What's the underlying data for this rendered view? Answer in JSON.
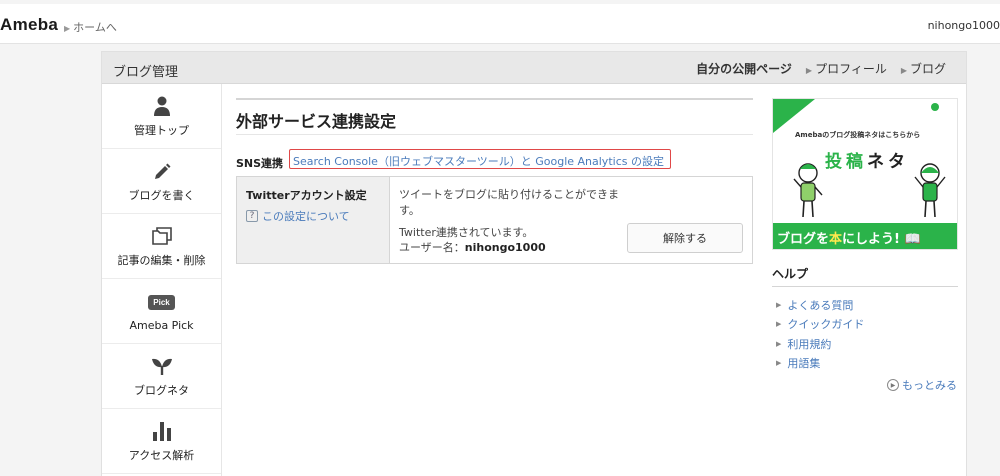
{
  "topbar": {
    "logo": "Ameba",
    "home_link": "ホームへ",
    "username": "nihongo1000"
  },
  "frame": {
    "title": "ブログ管理",
    "header_links": {
      "my_page": "自分の公開ページ",
      "profile": "プロフィール",
      "blog": "ブログ"
    }
  },
  "sidebar": {
    "items": [
      {
        "label": "管理トップ",
        "icon": "person-icon"
      },
      {
        "label": "ブログを書く",
        "icon": "pencil-icon"
      },
      {
        "label": "記事の編集・削除",
        "icon": "folder-icon"
      },
      {
        "label": "Ameba Pick",
        "icon": "pick-badge-icon",
        "badge": "Pick"
      },
      {
        "label": "ブログネタ",
        "icon": "sprout-icon"
      },
      {
        "label": "アクセス解析",
        "icon": "bar-chart-icon"
      }
    ]
  },
  "main": {
    "title": "外部サービス連携設定",
    "sns_label": "SNS連携",
    "sns_link": "Search Console（旧ウェブマスターツール）と Google Analytics の設定",
    "twitter": {
      "heading": "Twitterアカウント設定",
      "help_link": "この設定について",
      "description": "ツイートをブログに貼り付けることができます。",
      "status": "Twitter連携されています。",
      "username_label": "ユーザー名：",
      "username_value": "nihongo1000",
      "unlink_button": "解除する"
    }
  },
  "right": {
    "banner": {
      "subtitle": "Amebaのブログ投稿ネタはこちらから",
      "headline_part1": "投稿",
      "headline_part2": "ネタ",
      "cta_part1": "ブログを",
      "cta_part2": "本",
      "cta_part3": "にしよう!"
    },
    "help": {
      "title": "ヘルプ",
      "links": [
        "よくある質問",
        "クイックガイド",
        "利用規約",
        "用語集"
      ],
      "more": "もっとみる"
    }
  },
  "colors": {
    "accent_green": "#2bb34a",
    "link_blue": "#4a7bbb",
    "highlight_red": "#e04848"
  }
}
